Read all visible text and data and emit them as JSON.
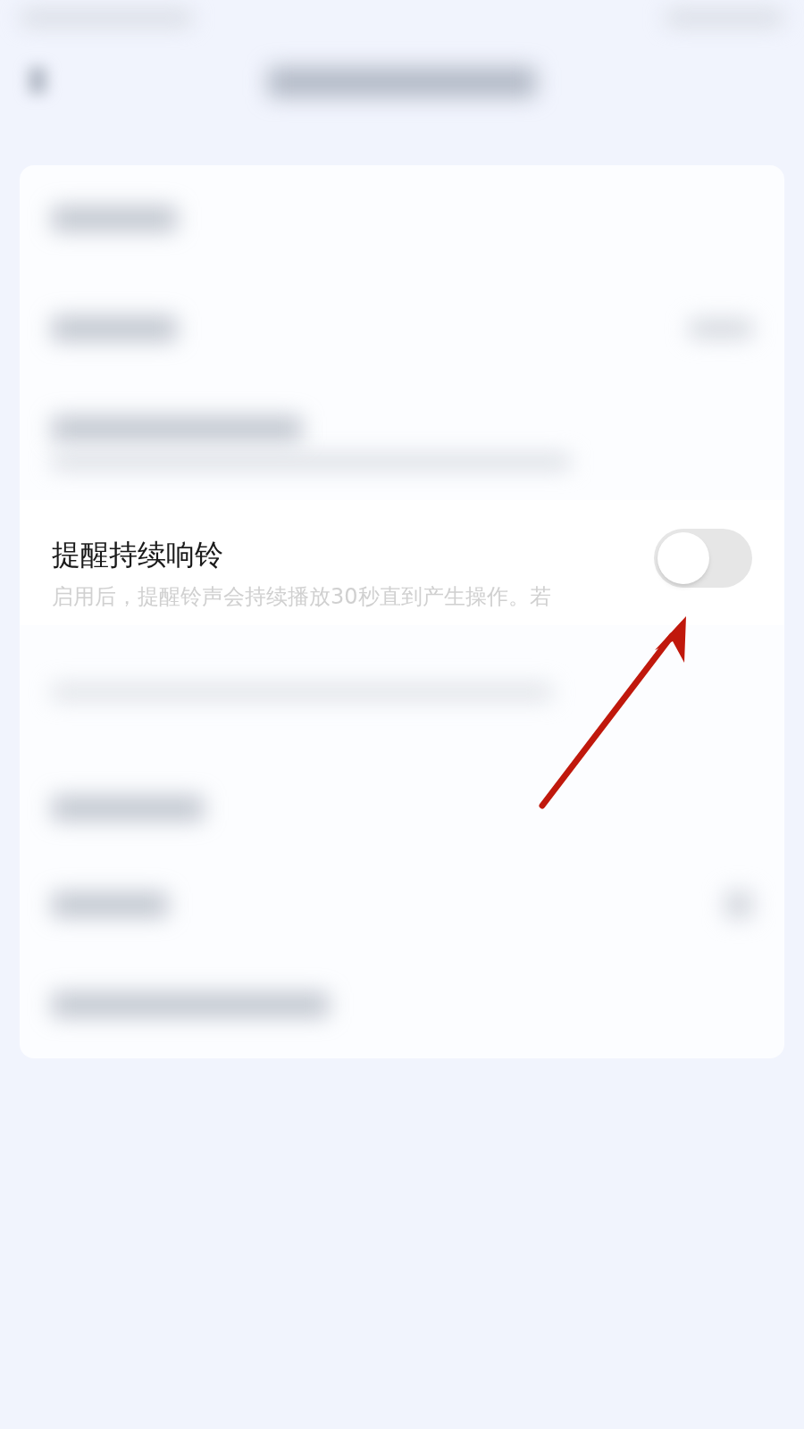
{
  "setting": {
    "title": "提醒持续响铃",
    "description": "启用后，提醒铃声会持续播放30秒直到产生操作。若",
    "on": false
  }
}
